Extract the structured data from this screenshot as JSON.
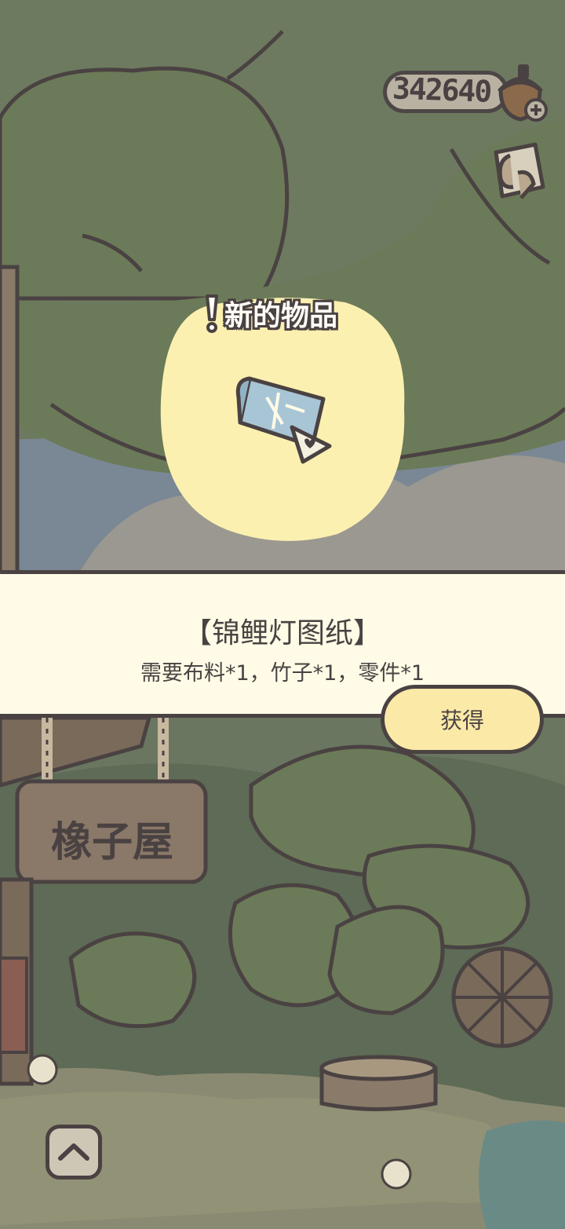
{
  "hud": {
    "acorn_count": "342640",
    "acorn_icon": "acorn-plus-icon",
    "map_icon": "map-icon"
  },
  "popup": {
    "title": "新的物品",
    "item_icon": "blueprint-scroll-icon",
    "item_name": "【锦鲤灯图纸】",
    "requirements": "需要布料*1，竹子*1，零件*1",
    "get_button_label": "获得"
  },
  "scene": {
    "shop_sign": "橡子屋",
    "up_button_icon": "chevron-up-icon"
  },
  "colors": {
    "outline": "#4a4242",
    "banner_bg": "#fffbe6",
    "button_bg": "#fbe9a8",
    "glow": "#fbf0b0",
    "foliage": "#6b7560"
  }
}
